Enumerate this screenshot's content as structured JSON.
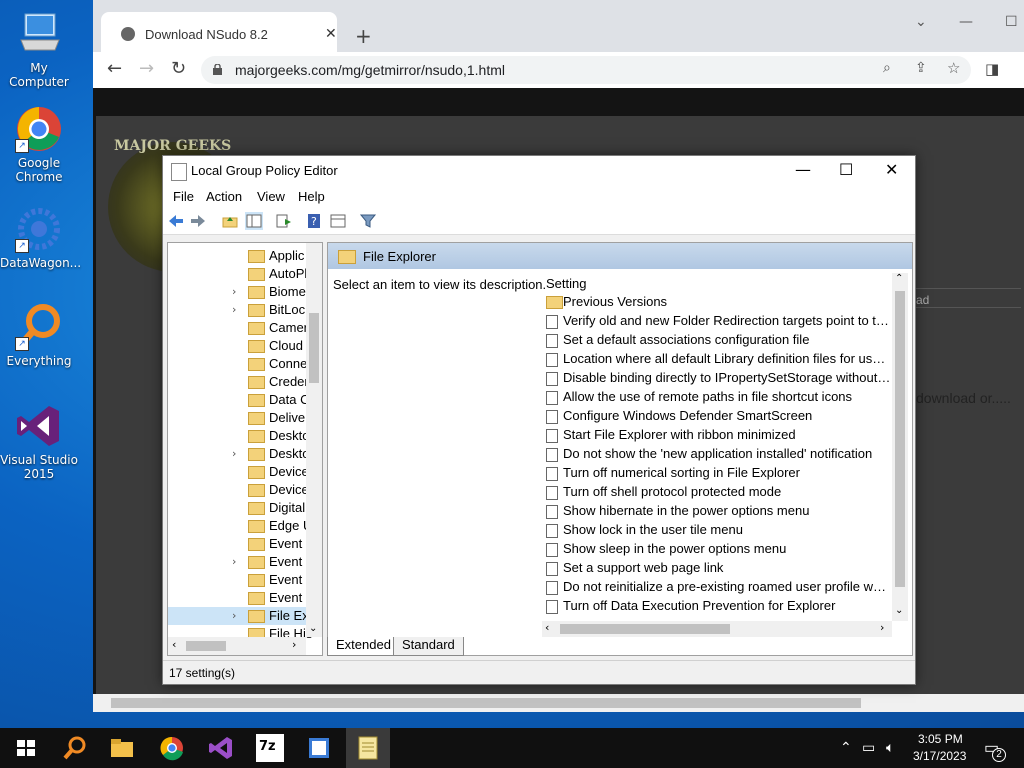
{
  "desktop": {
    "icons": [
      {
        "label": "My Computer"
      },
      {
        "label": "Google Chrome"
      },
      {
        "label": "DataWagon..."
      },
      {
        "label": "Everything"
      },
      {
        "label": "Visual Studio 2015"
      }
    ]
  },
  "browser": {
    "tab_title": "Download NSudo 8.2",
    "url": "majorgeeks.com/mg/getmirror/nsudo,1.html",
    "page_logo_text": "MAJOR GEEKS",
    "page_side_text_1": "ad",
    "page_side_text_2": "download or....."
  },
  "gpe": {
    "title": "Local Group Policy Editor",
    "menu": [
      "File",
      "Action",
      "View",
      "Help"
    ],
    "tree": [
      {
        "label": "Applic",
        "arrow": ""
      },
      {
        "label": "AutoPl",
        "arrow": ""
      },
      {
        "label": "Biome",
        "arrow": "›"
      },
      {
        "label": "BitLocl",
        "arrow": "›"
      },
      {
        "label": "Camer",
        "arrow": ""
      },
      {
        "label": "Cloud",
        "arrow": ""
      },
      {
        "label": "Conne",
        "arrow": ""
      },
      {
        "label": "Creder",
        "arrow": ""
      },
      {
        "label": "Data C",
        "arrow": ""
      },
      {
        "label": "Deliver",
        "arrow": ""
      },
      {
        "label": "Deskto",
        "arrow": ""
      },
      {
        "label": "Deskto",
        "arrow": "›"
      },
      {
        "label": "Device",
        "arrow": ""
      },
      {
        "label": "Device",
        "arrow": ""
      },
      {
        "label": "Digital",
        "arrow": ""
      },
      {
        "label": "Edge U",
        "arrow": ""
      },
      {
        "label": "Event F",
        "arrow": ""
      },
      {
        "label": "Event L",
        "arrow": "›"
      },
      {
        "label": "Event L",
        "arrow": ""
      },
      {
        "label": "Event V",
        "arrow": ""
      },
      {
        "label": "File Exp",
        "arrow": "›",
        "selected": true
      },
      {
        "label": "File His",
        "arrow": ""
      }
    ],
    "header_title": "File Explorer",
    "description": "Select an item to view its description.",
    "column_setting": "Setting",
    "settings": [
      {
        "label": "Previous Versions",
        "folder": true
      },
      {
        "label": "Verify old and new Folder Redirection targets point to the sa..."
      },
      {
        "label": "Set a default associations configuration file"
      },
      {
        "label": "Location where all default Library definition files for users/m..."
      },
      {
        "label": "Disable binding directly to IPropertySetStorage without inter..."
      },
      {
        "label": "Allow the use of remote paths in file shortcut icons"
      },
      {
        "label": "Configure Windows Defender SmartScreen"
      },
      {
        "label": "Start File Explorer with ribbon minimized"
      },
      {
        "label": "Do not show the 'new application installed' notification"
      },
      {
        "label": "Turn off numerical sorting in File Explorer"
      },
      {
        "label": "Turn off shell protocol protected mode"
      },
      {
        "label": "Show hibernate in the power options menu"
      },
      {
        "label": "Show lock in the user tile menu"
      },
      {
        "label": "Show sleep in the power options menu"
      },
      {
        "label": "Set a support web page link"
      },
      {
        "label": "Do not reinitialize a pre-existing roamed user profile when it..."
      },
      {
        "label": "Turn off Data Execution Prevention for Explorer"
      }
    ],
    "tab_extended": "Extended",
    "tab_standard": "Standard",
    "status": "17 setting(s)"
  },
  "taskbar": {
    "time": "3:05 PM",
    "date": "3/17/2023",
    "notifications": "2",
    "app_7zip": "7z"
  }
}
